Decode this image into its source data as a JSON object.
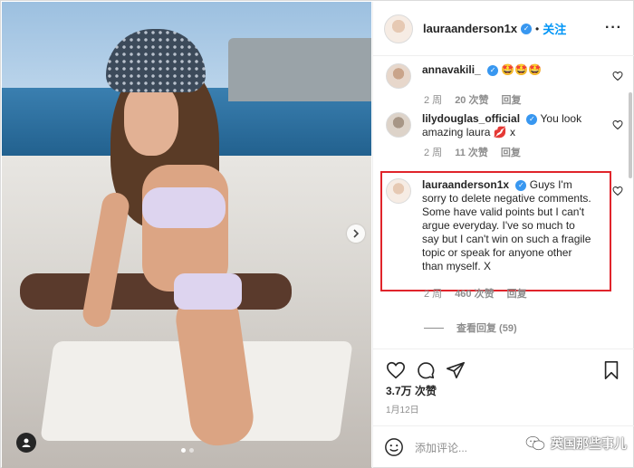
{
  "post": {
    "author": "lauraanderson1x",
    "follow_label": "关注",
    "more_label": "···",
    "separator": "•"
  },
  "comments": [
    {
      "username": "annavakili_",
      "verified": true,
      "text": "🤩🤩🤩",
      "time": "2 周",
      "likes": "20 次赞",
      "reply_label": "回复"
    },
    {
      "username": "lilydouglas_official",
      "verified": true,
      "text": "You look amazing laura 💋 x",
      "time": "2 周",
      "likes": "11 次赞",
      "reply_label": "回复"
    },
    {
      "username": "lauraanderson1x",
      "verified": true,
      "text": "Guys I'm sorry to delete negative comments. Some have valid points but I can't argue everyday. I've so much to say but I can't win on such a fragile topic or speak for anyone other than myself. X",
      "time": "2 周",
      "likes": "460 次赞",
      "reply_label": "回复"
    }
  ],
  "view_replies": "查看回复 (59)",
  "likes_count": "3.7万 次赞",
  "date": "1月12日",
  "add_comment_placeholder": "添加评论...",
  "watermark_text": "英国那些事儿",
  "colors": {
    "accent": "#0095f6",
    "verified": "#3897f0",
    "highlight": "#e0242b"
  },
  "carousel": {
    "slides": 2,
    "active": 0
  }
}
